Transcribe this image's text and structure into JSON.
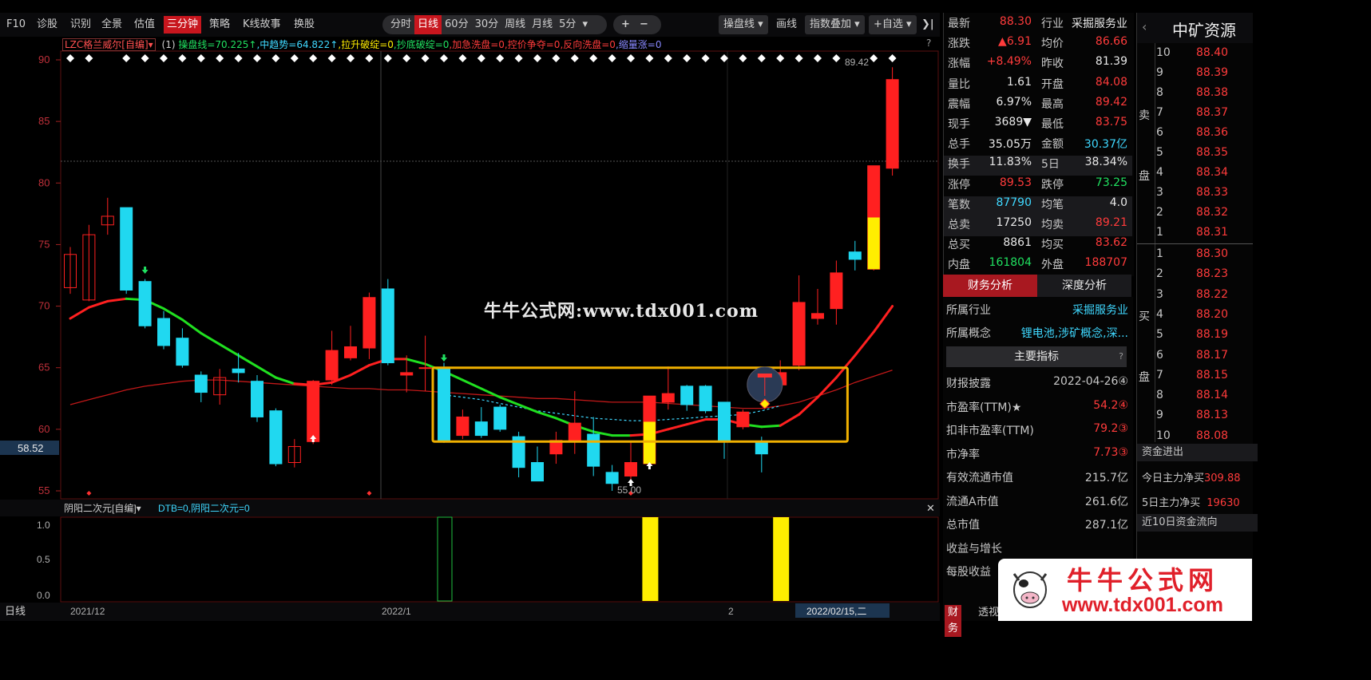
{
  "toolbar": {
    "left_items": [
      "F10",
      "诊股",
      "识别",
      "全景",
      "估值",
      "三分钟",
      "策略",
      "K线故事",
      "换股"
    ],
    "active_left": "三分钟",
    "periods": [
      "分时",
      "日线",
      "60分",
      "30分",
      "周线",
      "月线",
      "5分"
    ],
    "active_period": "日线",
    "five_min_caret": "▾",
    "zoom_plus": "+",
    "zoom_minus": "−",
    "op_line": "操盘线",
    "draw": "画线",
    "index_overlay": "指数叠加",
    "add_fav": "+自选",
    "collapse": "❯|"
  },
  "indicator_line": {
    "name": "LZC格兰威尔[自编]▾",
    "n": "(1)",
    "items": [
      {
        "text": "操盘线=70.225↑",
        "color": "#20e060"
      },
      {
        "text": "中趋势=64.822↑",
        "color": "#3fd8ff"
      },
      {
        "text": "拉升破绽=0",
        "color": "#ffee00"
      },
      {
        "text": "抄底破绽=0",
        "color": "#20e060"
      },
      {
        "text": "加急洗盘=0",
        "color": "#ff3b3b"
      },
      {
        "text": "控价争夺=0",
        "color": "#ff3b3b"
      },
      {
        "text": "反向洗盘=0",
        "color": "#ff3b3b"
      },
      {
        "text": "缩量涨=0",
        "color": "#8888ff"
      }
    ],
    "help": "?"
  },
  "price_axis": {
    "ticks": [
      "90",
      "85",
      "80",
      "75",
      "70",
      "65",
      "60",
      "55"
    ],
    "current_label": "58.52",
    "high_label": "89.42",
    "low_label": "55.00"
  },
  "sub_indicator": {
    "name": "阴阳二次元[自编]▾",
    "values": "DTB=0,阴阳二次元=0",
    "close": "✕",
    "ticks": [
      "1.0",
      "0.5",
      "0.0"
    ]
  },
  "x_axis": {
    "period_label": "日线",
    "dates": [
      "2021/12",
      "2022/1",
      "2"
    ],
    "cursor_date": "2022/02/15,二"
  },
  "site_watermark": "牛牛公式网:www.tdx001.com",
  "chart_data": {
    "type": "candlestick",
    "ylim": [
      54,
      91
    ],
    "candles": [
      {
        "o": 71.5,
        "c": 74.2,
        "h": 74.8,
        "l": 71.0
      },
      {
        "o": 70.5,
        "c": 75.8,
        "h": 76.6,
        "l": 70.4
      },
      {
        "o": 76.6,
        "c": 77.3,
        "h": 78.8,
        "l": 75.8
      },
      {
        "o": 78.0,
        "c": 71.3,
        "h": 78.0,
        "l": 71.0
      },
      {
        "o": 72.0,
        "c": 68.4,
        "h": 72.2,
        "l": 68.2
      },
      {
        "o": 69.0,
        "c": 66.8,
        "h": 69.6,
        "l": 66.5
      },
      {
        "o": 67.4,
        "c": 65.2,
        "h": 68.2,
        "l": 65.0
      },
      {
        "o": 64.4,
        "c": 63.0,
        "h": 64.7,
        "l": 62.2
      },
      {
        "o": 62.8,
        "c": 64.2,
        "h": 64.9,
        "l": 62.0
      },
      {
        "o": 64.9,
        "c": 64.6,
        "h": 66.2,
        "l": 63.8
      },
      {
        "o": 63.9,
        "c": 61.0,
        "h": 64.4,
        "l": 60.6
      },
      {
        "o": 61.5,
        "c": 57.2,
        "h": 61.7,
        "l": 57.0
      },
      {
        "o": 57.3,
        "c": 58.6,
        "h": 59.2,
        "l": 56.9
      },
      {
        "o": 59.0,
        "c": 63.9,
        "h": 64.0,
        "l": 58.8
      },
      {
        "o": 64.0,
        "c": 66.4,
        "h": 68.0,
        "l": 63.6
      },
      {
        "o": 65.8,
        "c": 66.7,
        "h": 68.4,
        "l": 65.6
      },
      {
        "o": 66.6,
        "c": 70.7,
        "h": 71.1,
        "l": 65.7
      },
      {
        "o": 71.4,
        "c": 65.4,
        "h": 72.2,
        "l": 65.2
      },
      {
        "o": 64.4,
        "c": 64.6,
        "h": 66.0,
        "l": 63.0
      },
      {
        "o": 65.0,
        "c": 65.0,
        "h": 67.6,
        "l": 63.1
      },
      {
        "o": 65.0,
        "c": 59.0,
        "h": 65.4,
        "l": 58.9
      },
      {
        "o": 59.5,
        "c": 61.0,
        "h": 61.6,
        "l": 59.2
      },
      {
        "o": 60.6,
        "c": 59.5,
        "h": 61.8,
        "l": 59.3
      },
      {
        "o": 61.8,
        "c": 60.0,
        "h": 62.0,
        "l": 59.8
      },
      {
        "o": 59.4,
        "c": 56.9,
        "h": 59.8,
        "l": 56.1
      },
      {
        "o": 57.3,
        "c": 55.8,
        "h": 58.6,
        "l": 55.8
      },
      {
        "o": 58.0,
        "c": 59.1,
        "h": 59.8,
        "l": 57.2
      },
      {
        "o": 59.0,
        "c": 60.5,
        "h": 63.1,
        "l": 58.0
      },
      {
        "o": 59.6,
        "c": 57.0,
        "h": 61.0,
        "l": 56.2
      },
      {
        "o": 56.5,
        "c": 55.6,
        "h": 57.1,
        "l": 55.0
      },
      {
        "o": 56.2,
        "c": 57.3,
        "h": 59.0,
        "l": 55.8
      },
      {
        "o": 57.2,
        "c": 62.7,
        "h": 62.7,
        "l": 56.8
      },
      {
        "o": 62.2,
        "c": 62.9,
        "h": 65.1,
        "l": 61.6
      },
      {
        "o": 63.5,
        "c": 62.0,
        "h": 63.6,
        "l": 61.5
      },
      {
        "o": 63.5,
        "c": 61.5,
        "h": 63.6,
        "l": 61.3
      },
      {
        "o": 62.2,
        "c": 59.0,
        "h": 62.2,
        "l": 57.6
      },
      {
        "o": 60.2,
        "c": 61.4,
        "h": 61.6,
        "l": 60.0
      },
      {
        "o": 59.0,
        "c": 58.0,
        "h": 59.4,
        "l": 56.5
      },
      {
        "o": 63.6,
        "c": 64.6,
        "h": 65.6,
        "l": 63.2
      },
      {
        "o": 65.2,
        "c": 70.3,
        "h": 72.5,
        "l": 64.8
      },
      {
        "o": 69.0,
        "c": 69.4,
        "h": 71.4,
        "l": 68.5
      },
      {
        "o": 69.8,
        "c": 72.7,
        "h": 73.7,
        "l": 68.5
      },
      {
        "o": 74.4,
        "c": 73.8,
        "h": 75.3,
        "l": 72.9
      },
      {
        "o": 73.0,
        "c": 81.4,
        "h": 81.4,
        "l": 72.9
      },
      {
        "o": 81.2,
        "c": 88.4,
        "h": 89.4,
        "l": 80.6
      }
    ],
    "yellow_body_indices": [
      31,
      43
    ],
    "diamond_top_indices": [
      0,
      1,
      3,
      4,
      5,
      6,
      7,
      8,
      9,
      10,
      11,
      12,
      13,
      14,
      15,
      16,
      17,
      18,
      19,
      20,
      21,
      22,
      23,
      24,
      25,
      26,
      27,
      28,
      29,
      30,
      31,
      32,
      33,
      34,
      35,
      36,
      37,
      38,
      39,
      40,
      41,
      43,
      44
    ],
    "op_line": [
      69.0,
      69.9,
      70.4,
      70.6,
      70.5,
      69.8,
      68.9,
      67.8,
      66.9,
      66.0,
      65.1,
      64.2,
      63.7,
      63.6,
      63.8,
      64.4,
      65.2,
      65.7,
      65.7,
      65.3,
      64.7,
      64.0,
      63.3,
      62.6,
      62.0,
      61.4,
      60.9,
      60.3,
      59.8,
      59.5,
      59.5,
      59.6,
      60.0,
      60.4,
      60.8,
      60.8,
      60.4,
      60.2,
      60.3,
      61.2,
      62.6,
      64.2,
      66.0,
      67.9,
      70.0
    ],
    "op_line_green_ranges": [
      [
        3,
        12
      ],
      [
        18,
        30
      ],
      [
        36,
        38
      ]
    ],
    "mid_trend": [
      62.0,
      62.4,
      62.8,
      63.2,
      63.5,
      63.7,
      63.9,
      64.0,
      64.0,
      63.9,
      63.8,
      63.7,
      63.6,
      63.5,
      63.4,
      63.3,
      63.3,
      63.2,
      63.2,
      63.1,
      63.0,
      62.9,
      62.8,
      62.7,
      62.6,
      62.5,
      62.5,
      62.4,
      62.3,
      62.2,
      62.2,
      62.2,
      62.1,
      62.0,
      61.9,
      61.8,
      61.7,
      61.7,
      61.9,
      62.2,
      62.7,
      63.2,
      63.8,
      64.3,
      64.8
    ],
    "dotted_line": [
      null,
      null,
      null,
      null,
      null,
      null,
      null,
      null,
      null,
      null,
      null,
      null,
      null,
      null,
      null,
      null,
      null,
      null,
      null,
      null,
      62.8,
      62.6,
      62.4,
      62.1,
      61.8,
      61.5,
      61.3,
      61.1,
      60.9,
      60.8,
      60.7,
      60.7,
      60.8,
      60.9,
      61.0,
      61.1,
      61.2,
      61.5,
      61.9,
      null,
      null,
      null,
      null,
      null,
      null
    ],
    "box": {
      "from_index": 20,
      "to_index": 41,
      "top": 65.0,
      "bottom": 59.0
    },
    "sub_bars": [
      {
        "index": 20,
        "value": 1.0,
        "style": "outline-green"
      },
      {
        "index": 31,
        "value": 1.0,
        "style": "yellow"
      },
      {
        "index": 38,
        "value": 1.0,
        "style": "yellow"
      }
    ],
    "dates": [
      "2021/12",
      "2022/1",
      "2"
    ]
  },
  "quote": {
    "rows": [
      {
        "l": "最新",
        "v": "88.30",
        "vc": "#ff3b3b",
        "l2": "行业",
        "v2": "采掘服务业",
        "v2c": "#e8e8e8"
      },
      {
        "l": "涨跌",
        "v": "▲6.91",
        "vc": "#ff3b3b",
        "l2": "均价",
        "v2": "86.66",
        "v2c": "#ff3b3b"
      },
      {
        "l": "涨幅",
        "v": "+8.49%",
        "vc": "#ff3b3b",
        "l2": "昨收",
        "v2": "81.39",
        "v2c": "#e8e8e8"
      },
      {
        "l": "量比",
        "v": "1.61",
        "vc": "#e8e8e8",
        "l2": "开盘",
        "v2": "84.08",
        "v2c": "#ff3b3b"
      },
      {
        "l": "震幅",
        "v": "6.97%",
        "vc": "#e8e8e8",
        "l2": "最高",
        "v2": "89.42",
        "v2c": "#ff3b3b"
      },
      {
        "l": "现手",
        "v": "3689▼",
        "vc": "#e8e8e8",
        "l2": "最低",
        "v2": "83.75",
        "v2c": "#ff3b3b"
      },
      {
        "l": "总手",
        "v": "35.05万",
        "vc": "#e8e8e8",
        "l2": "金额",
        "v2": "30.37亿",
        "v2c": "#3fd8ff"
      },
      {
        "l": "换手",
        "v": "11.83%",
        "vc": "#e8e8e8",
        "l2": "5日",
        "v2": "38.34%",
        "v2c": "#e8e8e8"
      },
      {
        "l": "涨停",
        "v": "89.53",
        "vc": "#ff3b3b",
        "l2": "跌停",
        "v2": "73.25",
        "v2c": "#20e060"
      },
      {
        "l": "笔数",
        "v": "87790",
        "vc": "#3fd8ff",
        "l2": "均笔",
        "v2": "4.0",
        "v2c": "#e8e8e8"
      },
      {
        "l": "总卖",
        "v": "17250",
        "vc": "#e8e8e8",
        "l2": "均卖",
        "v2": "89.21",
        "v2c": "#ff3b3b"
      },
      {
        "l": "总买",
        "v": "8861",
        "vc": "#e8e8e8",
        "l2": "均买",
        "v2": "83.62",
        "v2c": "#ff3b3b"
      },
      {
        "l": "内盘",
        "v": "161804",
        "vc": "#20e060",
        "l2": "外盘",
        "v2": "188707",
        "v2c": "#ff3b3b"
      }
    ]
  },
  "fin": {
    "tab1": "财务分析",
    "tab2": "深度分析",
    "industry_label": "所属行业",
    "industry": "采掘服务业",
    "concept_label": "所属概念",
    "concept": "锂电池,涉矿概念,深...",
    "main_index": "主要指标",
    "rows": [
      {
        "l": "财报披露",
        "v": "2022-04-26④",
        "c": "#c8c8c8"
      },
      {
        "l": "市盈率(TTM)★",
        "v": "54.2④",
        "c": "#ff3b3b"
      },
      {
        "l": "扣非市盈率(TTM)",
        "v": "79.2③",
        "c": "#ff3b3b"
      },
      {
        "l": "市净率",
        "v": "7.73③",
        "c": "#ff3b3b"
      },
      {
        "l": "有效流通市值",
        "v": "215.7亿",
        "c": "#c8c8c8"
      },
      {
        "l": "流通A市值",
        "v": "261.6亿",
        "c": "#c8c8c8"
      },
      {
        "l": "总市值",
        "v": "287.1亿",
        "c": "#c8c8c8"
      },
      {
        "l": "收益与增长",
        "v": "",
        "c": "#c8c8c8"
      },
      {
        "l": "每股收益",
        "v": "",
        "c": "#c8c8c8"
      }
    ],
    "bottom_tabs": [
      "财务",
      "透视"
    ]
  },
  "book": {
    "stock_name": "中矿资源",
    "sell_label": "卖",
    "buy_label": "买",
    "disk_label": "盘",
    "sells": [
      {
        "n": "10",
        "p": "88.40"
      },
      {
        "n": "9",
        "p": "88.39"
      },
      {
        "n": "8",
        "p": "88.38"
      },
      {
        "n": "7",
        "p": "88.37"
      },
      {
        "n": "6",
        "p": "88.36"
      },
      {
        "n": "5",
        "p": "88.35"
      },
      {
        "n": "4",
        "p": "88.34"
      },
      {
        "n": "3",
        "p": "88.33"
      },
      {
        "n": "2",
        "p": "88.32"
      },
      {
        "n": "1",
        "p": "88.31"
      }
    ],
    "buys": [
      {
        "n": "1",
        "p": "88.30"
      },
      {
        "n": "2",
        "p": "88.23"
      },
      {
        "n": "3",
        "p": "88.22"
      },
      {
        "n": "4",
        "p": "88.20"
      },
      {
        "n": "5",
        "p": "88.19"
      },
      {
        "n": "6",
        "p": "88.17"
      },
      {
        "n": "7",
        "p": "88.15"
      },
      {
        "n": "8",
        "p": "88.14"
      },
      {
        "n": "9",
        "p": "88.13"
      },
      {
        "n": "10",
        "p": "88.08"
      }
    ]
  },
  "flow": {
    "title": "资金进出",
    "today_label": "今日主力净买",
    "today_value": "309.88",
    "five_label": "5日主力净买",
    "five_value": "19630",
    "ten_label": "近10日资金流向"
  },
  "logo": {
    "text": "牛牛公式网",
    "url": "www.tdx001.com"
  }
}
